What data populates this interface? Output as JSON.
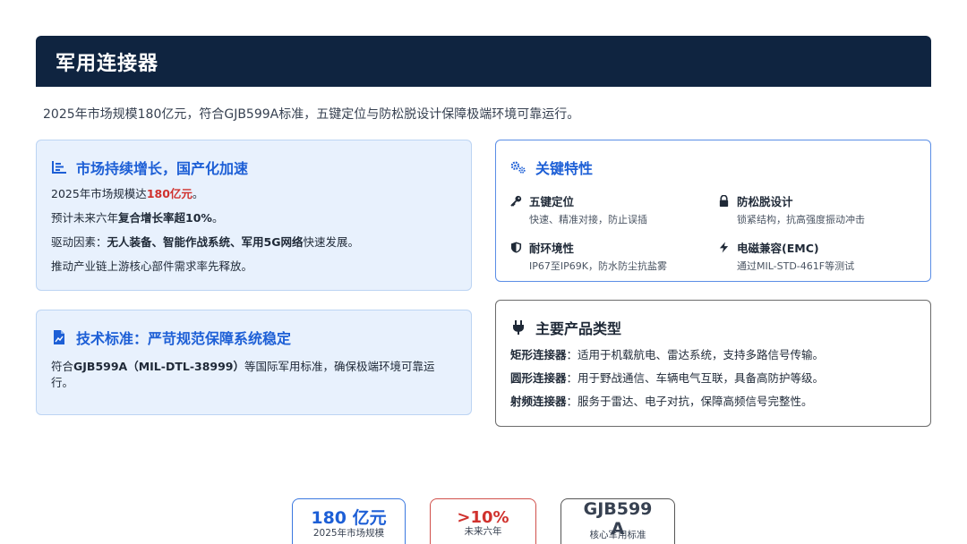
{
  "header": {
    "title": "军用连接器"
  },
  "intro": "2025年市场规模180亿元，符合GJB599A标准，五键定位与防松脱设计保障极端环境可靠运行。",
  "market": {
    "title": "市场持续增长，国产化加速",
    "l1_pre": "2025年市场规模达",
    "l1_hl": "180亿元",
    "l1_post": "。",
    "l2_pre": "预计未来六年",
    "l2_b": "复合增长率超10%",
    "l2_post": "。",
    "l3_pre": "驱动因素：",
    "l3_b": "无人装备、智能作战系统、军用5G网络",
    "l3_post": "快速发展。",
    "l4": "推动产业链上游核心部件需求率先释放。"
  },
  "standard": {
    "title": "技术标准：严苛规范保障系统稳定",
    "pre": "符合",
    "b": "GJB599A（MIL-DTL-38999）",
    "post": "等国际军用标准，确保极端环境可靠运行。"
  },
  "features": {
    "title": "关键特性",
    "items": [
      {
        "name": "五键定位",
        "desc": "快速、精准对接，防止误插",
        "icon": "key-icon"
      },
      {
        "name": "防松脱设计",
        "desc": "锁紧结构，抗高强度振动冲击",
        "icon": "lock-icon"
      },
      {
        "name": "耐环境性",
        "desc": "IP67至IP69K，防水防尘抗盐雾",
        "icon": "shield-icon"
      },
      {
        "name": "电磁兼容(EMC)",
        "desc": "通过MIL-STD-461F等测试",
        "icon": "bolt-icon"
      }
    ]
  },
  "products": {
    "title": "主要产品类型",
    "items": [
      {
        "name": "矩形连接器",
        "sep": "：",
        "desc": "适用于机载航电、雷达系统，支持多路信号传输。"
      },
      {
        "name": "圆形连接器",
        "sep": "：",
        "desc": "用于野战通信、车辆电气互联，具备高防护等级。"
      },
      {
        "name": "射频连接器",
        "sep": "：",
        "desc": "服务于雷达、电子对抗，保障高频信号完整性。"
      }
    ]
  },
  "stats": [
    {
      "value": "180 亿元",
      "label": "2025年市场规模"
    },
    {
      "value": ">10%",
      "label": "未来六年"
    },
    {
      "value": "GJB599A",
      "label": "核心军用标准"
    }
  ],
  "colors": {
    "header_bg": "#0f2440",
    "accent_blue": "#1d5fd6",
    "accent_red": "#d0312d",
    "card_bg": "#e8f1fd"
  }
}
